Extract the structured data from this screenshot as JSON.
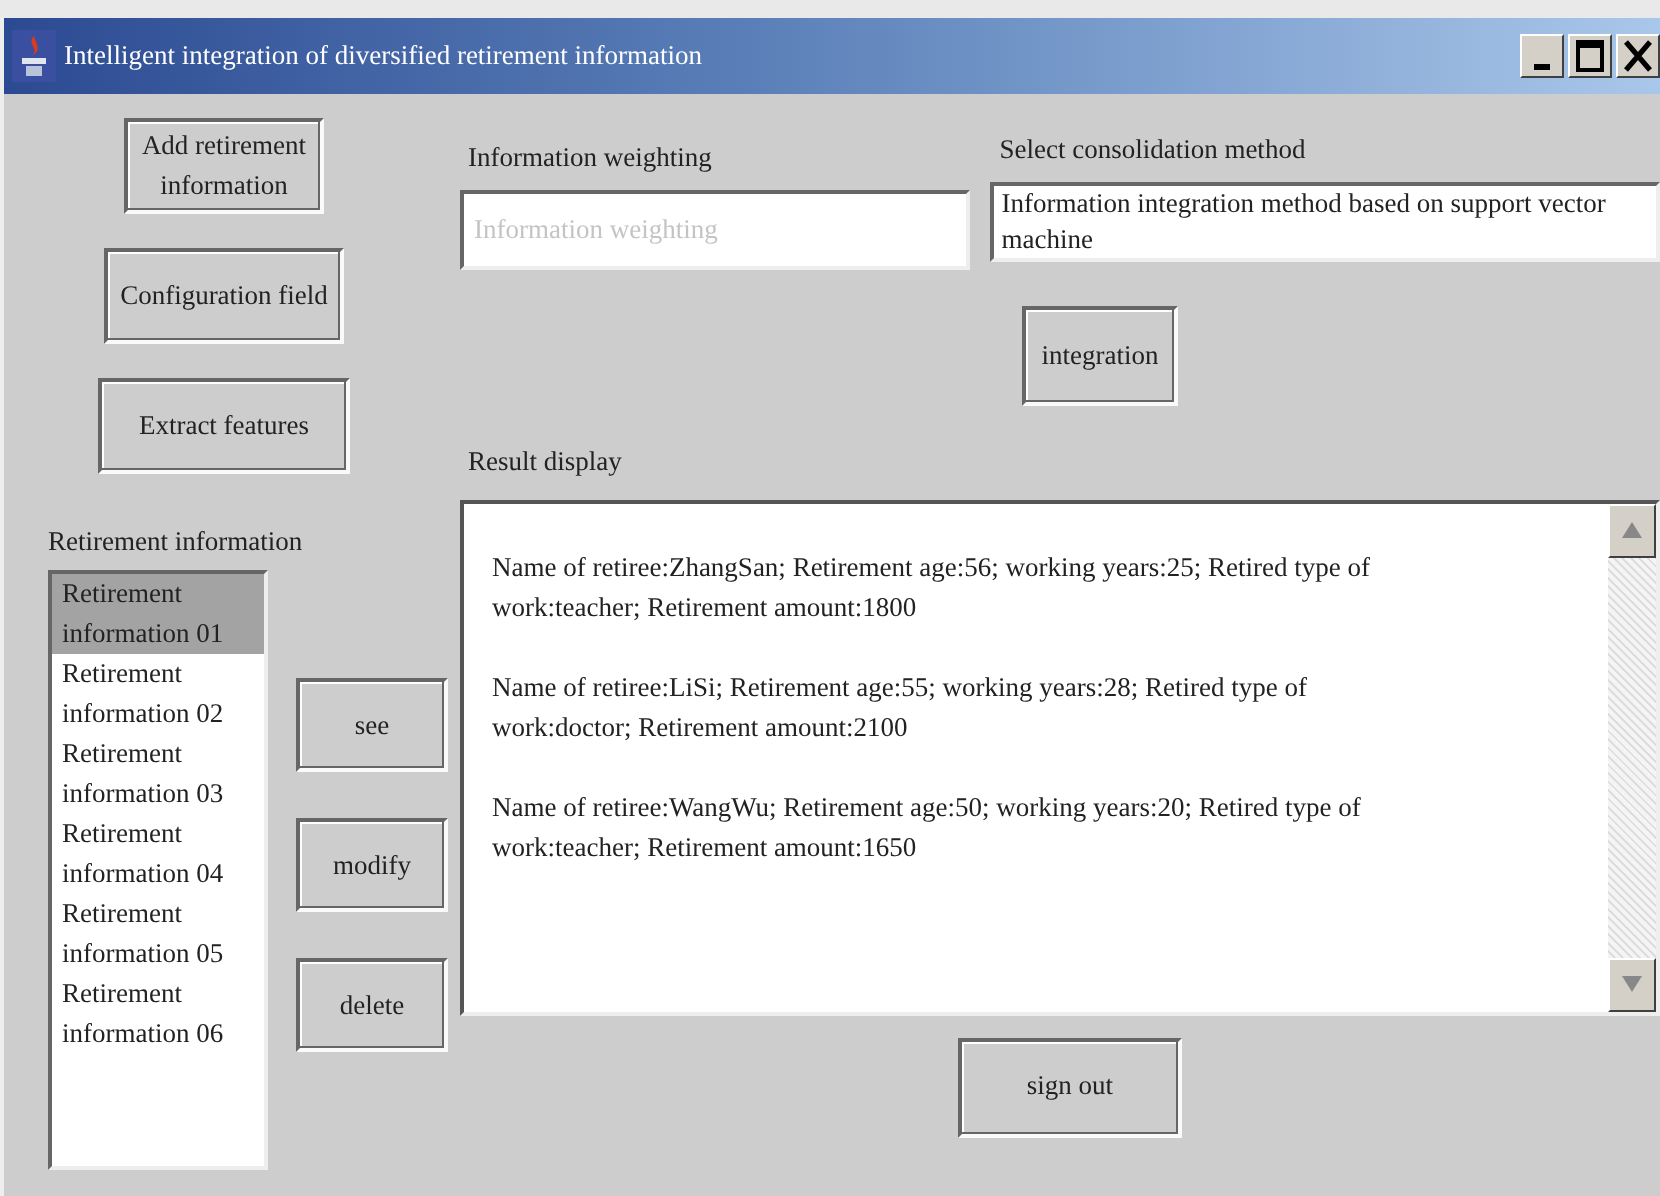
{
  "window": {
    "title": "Intelligent integration of diversified retirement information"
  },
  "side_buttons": [
    {
      "label": "Add retirement information"
    },
    {
      "label": "Configuration field"
    },
    {
      "label": "Extract features"
    }
  ],
  "list": {
    "label": "Retirement information",
    "items": [
      {
        "text": "Retirement information 01",
        "selected": true
      },
      {
        "text": "Retirement information 02",
        "selected": false
      },
      {
        "text": "Retirement information 03",
        "selected": false
      },
      {
        "text": "Retirement information 04",
        "selected": false
      },
      {
        "text": "Retirement information 05",
        "selected": false
      },
      {
        "text": "Retirement information 06",
        "selected": false
      }
    ]
  },
  "list_buttons": [
    {
      "label": "see"
    },
    {
      "label": "modify"
    },
    {
      "label": "delete"
    }
  ],
  "weighting": {
    "label": "Information weighting",
    "placeholder": "Information weighting"
  },
  "method": {
    "label": "Select consolidation method",
    "value": "Information integration method based on support vector machine"
  },
  "integrate_button": {
    "label": "integration"
  },
  "result": {
    "label": "Result display",
    "records": [
      "Name of retiree:ZhangSan; Retirement age:56; working years:25; Retired type of work:teacher; Retirement amount:1800",
      "Name of retiree:LiSi; Retirement age:55; working years:28; Retired type of work:doctor; Retirement amount:2100",
      "Name of retiree:WangWu; Retirement age:50; working years:20; Retired type of work:teacher; Retirement amount:1650"
    ]
  },
  "sign_out": {
    "label": "sign out"
  }
}
